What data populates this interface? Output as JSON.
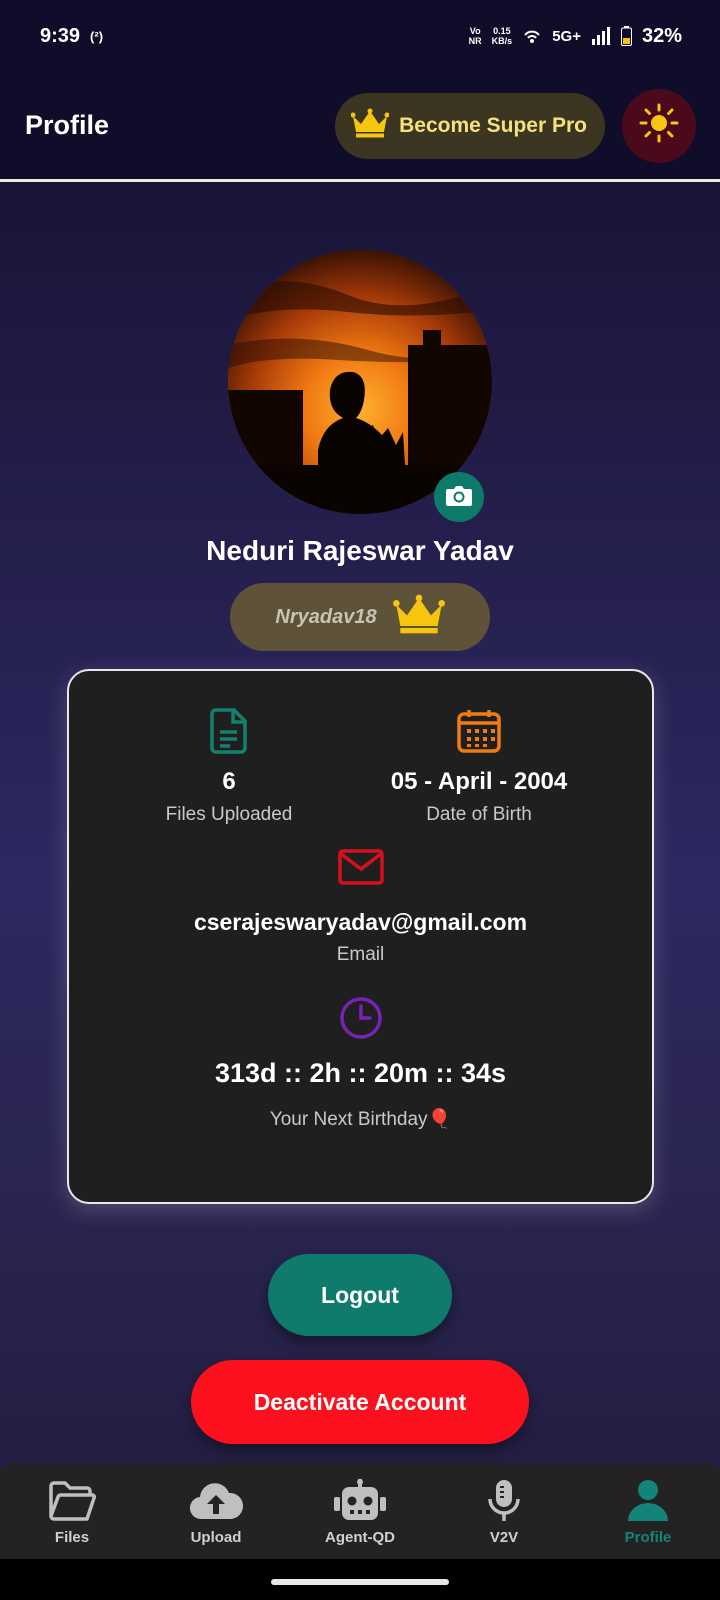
{
  "status_bar": {
    "time": "9:39",
    "hotspot_badge": "(²)",
    "volte_top": "Vo",
    "volte_bottom": "NR",
    "speed_value": "0.15",
    "speed_unit": "KB/s",
    "network": "5G+",
    "battery": "32%"
  },
  "header": {
    "title": "Profile",
    "super_pro_label": "Become Super Pro"
  },
  "profile": {
    "name": "Neduri Rajeswar Yadav",
    "username": "Nryadav18"
  },
  "stats": {
    "files_count": "6",
    "files_label": "Files Uploaded",
    "dob_value": "05 - April - 2004",
    "dob_label": "Date of Birth",
    "email_value": "cserajeswaryadav@gmail.com",
    "email_label": "Email",
    "countdown_value": "313d :: 2h :: 20m :: 34s",
    "countdown_label": "Your Next Birthday🎈"
  },
  "actions": {
    "logout": "Logout",
    "deactivate": "Deactivate Account"
  },
  "nav": {
    "items": [
      {
        "label": "Files",
        "icon": "folder-icon"
      },
      {
        "label": "Upload",
        "icon": "cloud-upload-icon"
      },
      {
        "label": "Agent-QD",
        "icon": "robot-icon"
      },
      {
        "label": "V2V",
        "icon": "microphone-icon"
      },
      {
        "label": "Profile",
        "icon": "user-icon"
      }
    ],
    "active": "Profile"
  },
  "colors": {
    "files_icon": "#14806f",
    "dob_icon": "#f07c10",
    "email_icon": "#d6101c",
    "clock_icon": "#7a22b8",
    "crown": "#f5c50f",
    "logout_bg": "#0f7b6c",
    "deactivate_bg": "#fc101d",
    "nav_active": "#12847a"
  }
}
